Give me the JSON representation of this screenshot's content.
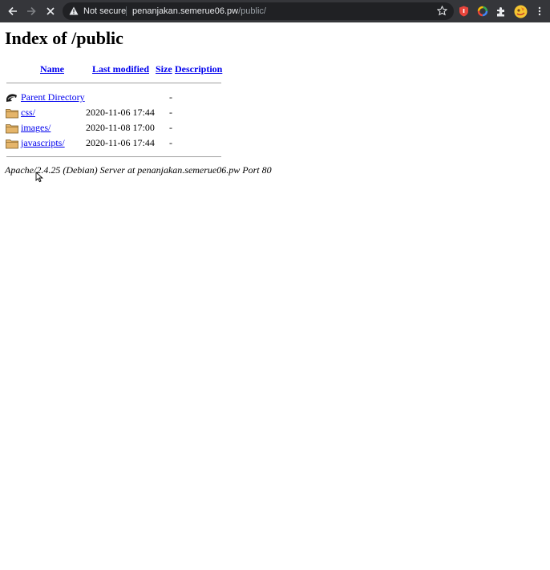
{
  "browser": {
    "security_label": "Not secure",
    "url_host": "penanjakan.semerue06.pw",
    "url_path": "/public/",
    "icons": [
      "back-icon",
      "forward-icon",
      "stop-icon",
      "warning-icon",
      "star-icon",
      "extension-red-icon",
      "extension-circle-icon",
      "puzzle-icon",
      "profile-avatar",
      "kebab-menu-icon"
    ]
  },
  "page": {
    "title": "Index of /public",
    "columns": {
      "name": "Name",
      "modified": "Last modified",
      "size": "Size",
      "description": "Description"
    },
    "parent": {
      "label": "Parent Directory",
      "size": "-"
    },
    "rows": [
      {
        "name": "css/",
        "modified": "2020-11-06 17:44",
        "size": "-"
      },
      {
        "name": "images/",
        "modified": "2020-11-08 17:00",
        "size": "-"
      },
      {
        "name": "javascripts/",
        "modified": "2020-11-06 17:44",
        "size": "-"
      }
    ],
    "address": "Apache/2.4.25 (Debian) Server at penanjakan.semerue06.pw Port 80"
  },
  "colors": {
    "toolbar": "#35363a",
    "omnibox": "#202124",
    "link": "#0000ee",
    "folder": "#e5b56a"
  }
}
